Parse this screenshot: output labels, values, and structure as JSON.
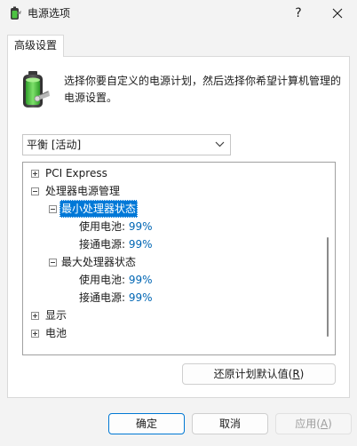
{
  "window": {
    "title": "电源选项",
    "help_label": "?",
    "close_label": "×"
  },
  "tabs": [
    {
      "label": "高级设置",
      "active": true
    }
  ],
  "description": "选择你要自定义的电源计划，然后选择你希望计算机管理的电源设置。",
  "plan_dropdown": {
    "selected": "平衡 [活动]"
  },
  "tree": {
    "pci_express": "PCI Express",
    "processor_power": "处理器电源管理",
    "min_state": {
      "label": "最小处理器状态",
      "on_battery_label": "使用电池:",
      "on_battery_value": "99%",
      "plugged_in_label": "接通电源:",
      "plugged_in_value": "99%"
    },
    "max_state": {
      "label": "最大处理器状态",
      "on_battery_label": "使用电池:",
      "on_battery_value": "99%",
      "plugged_in_label": "接通电源:",
      "plugged_in_value": "99%"
    },
    "display": "显示",
    "battery": "电池"
  },
  "buttons": {
    "restore_text": "还原计划默认值(",
    "restore_key": "R",
    "restore_close": ")",
    "ok": "确定",
    "cancel": "取消",
    "apply_text": "应用(",
    "apply_key": "A",
    "apply_close": ")"
  },
  "colors": {
    "accent": "#0078d7",
    "value_blue": "#0066b4"
  }
}
